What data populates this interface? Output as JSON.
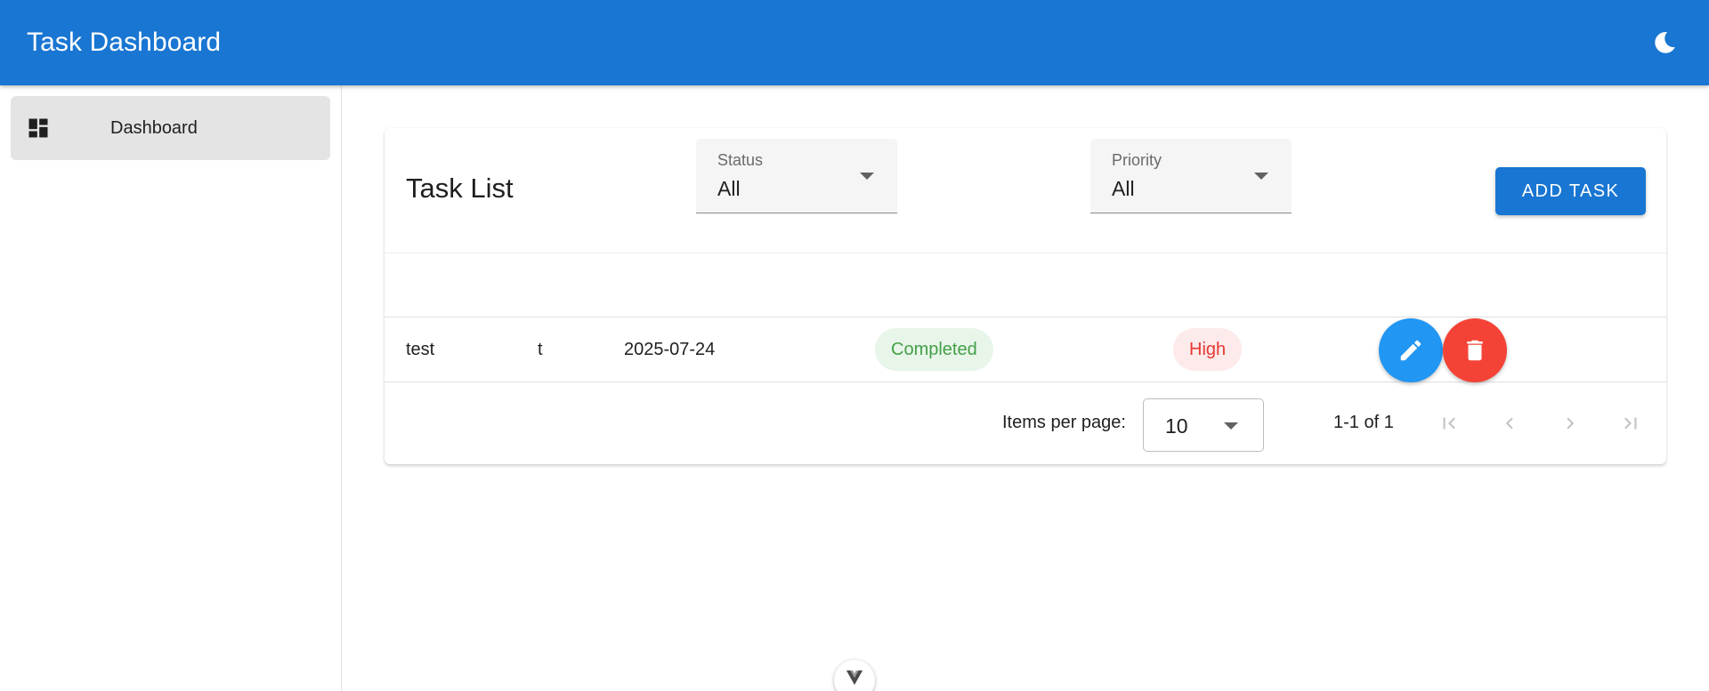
{
  "app_bar": {
    "title": "Task Dashboard",
    "theme_icon": "moon-icon",
    "color": "#1976d2"
  },
  "sidebar": {
    "items": [
      {
        "label": "Dashboard",
        "icon": "dashboard-icon",
        "active": true
      }
    ]
  },
  "task_list": {
    "title": "Task List",
    "filters": {
      "status": {
        "label": "Status",
        "value": "All"
      },
      "priority": {
        "label": "Priority",
        "value": "All"
      }
    },
    "add_button_label": "ADD TASK",
    "rows": [
      {
        "title": "test",
        "description": "t",
        "due_date": "2025-07-24",
        "status": "Completed",
        "priority": "High"
      }
    ],
    "status_colors": {
      "Completed": "#43a047"
    },
    "priority_colors": {
      "High": "#e53935"
    },
    "actions": {
      "edit_icon": "pencil-icon",
      "delete_icon": "trash-icon"
    }
  },
  "pagination": {
    "items_per_page_label": "Items per page:",
    "items_per_page_value": "10",
    "range_text": "1-1 of 1",
    "buttons": [
      "first-page-icon",
      "previous-page-icon",
      "next-page-icon",
      "last-page-icon"
    ]
  }
}
